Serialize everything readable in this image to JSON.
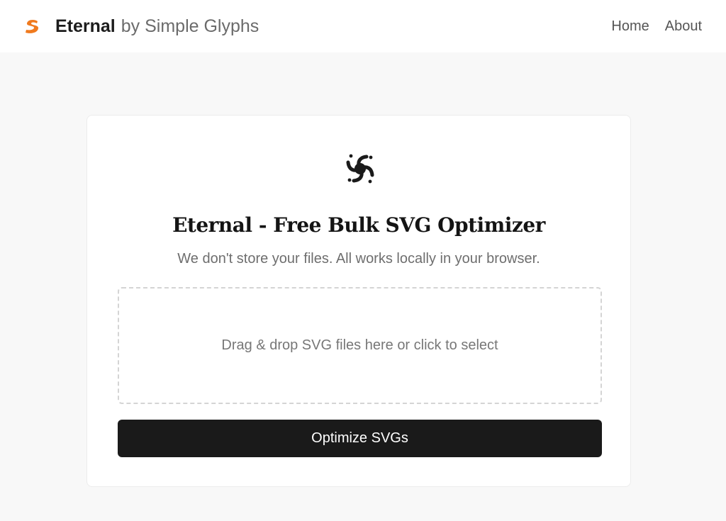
{
  "navbar": {
    "logo_icon": "orange-s-logo-icon",
    "brand_name": "Eternal",
    "brand_suffix": "by Simple Glyphs",
    "links": [
      {
        "label": "Home"
      },
      {
        "label": "About"
      }
    ]
  },
  "main": {
    "hero_icon": "swirl-vortex-icon",
    "title": "Eternal - Free Bulk SVG Optimizer",
    "subtitle": "We don't store your files. All works locally in your browser.",
    "dropzone_text": "Drag & drop SVG files here or click to select",
    "optimize_button_label": "Optimize SVGs"
  },
  "colors": {
    "accent": "#f07a1e",
    "button_bg": "#1a1a1a",
    "page_bg": "#f8f8f8"
  }
}
